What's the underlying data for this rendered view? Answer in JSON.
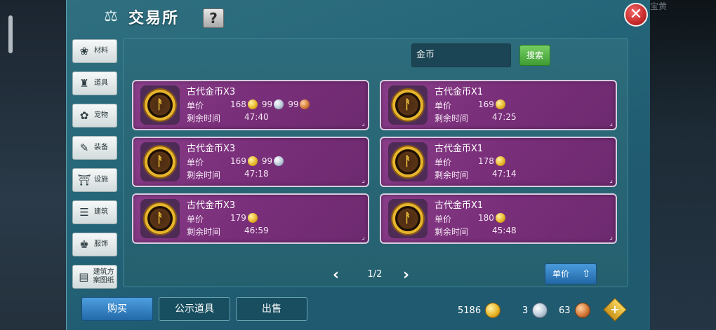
{
  "window": {
    "title": "交易所",
    "help_label": "?",
    "close_label": "✕",
    "corner_hint": "宝黄"
  },
  "sidebar": {
    "items": [
      {
        "label": "材料",
        "icon": "materials-icon",
        "glyph": "❀"
      },
      {
        "label": "道具",
        "icon": "potion-icon",
        "glyph": "♜"
      },
      {
        "label": "宠物",
        "icon": "paw-icon",
        "glyph": "✿"
      },
      {
        "label": "装备",
        "icon": "armor-icon",
        "glyph": "✎"
      },
      {
        "label": "设施",
        "icon": "facility-icon",
        "glyph": "⛩"
      },
      {
        "label": "建筑",
        "icon": "building-icon",
        "glyph": "☰"
      },
      {
        "label": "服饰",
        "icon": "clothing-icon",
        "glyph": "♚"
      },
      {
        "label": "建筑方案图纸",
        "icon": "blueprint-icon",
        "glyph": "▤"
      }
    ]
  },
  "search": {
    "value": "金币",
    "button_label": "搜索"
  },
  "listings": [
    {
      "name": "古代金币X3",
      "price_label": "单价",
      "time_label": "剩余时间",
      "time": "47:40",
      "prices": [
        {
          "amount": "168",
          "currency": "gold"
        },
        {
          "amount": "99",
          "currency": "silver"
        },
        {
          "amount": "99",
          "currency": "bronze"
        }
      ]
    },
    {
      "name": "古代金币X1",
      "price_label": "单价",
      "time_label": "剩余时间",
      "time": "47:25",
      "prices": [
        {
          "amount": "169",
          "currency": "gold"
        }
      ]
    },
    {
      "name": "古代金币X3",
      "price_label": "单价",
      "time_label": "剩余时间",
      "time": "47:18",
      "prices": [
        {
          "amount": "169",
          "currency": "gold"
        },
        {
          "amount": "99",
          "currency": "silver"
        }
      ]
    },
    {
      "name": "古代金币X1",
      "price_label": "单价",
      "time_label": "剩余时间",
      "time": "47:14",
      "prices": [
        {
          "amount": "178",
          "currency": "gold"
        }
      ]
    },
    {
      "name": "古代金币X3",
      "price_label": "单价",
      "time_label": "剩余时间",
      "time": "46:59",
      "prices": [
        {
          "amount": "179",
          "currency": "gold"
        }
      ]
    },
    {
      "name": "古代金币X1",
      "price_label": "单价",
      "time_label": "剩余时间",
      "time": "45:48",
      "prices": [
        {
          "amount": "180",
          "currency": "gold"
        }
      ]
    }
  ],
  "pagination": {
    "prev_label": "‹",
    "next_label": "›",
    "text": "1/2"
  },
  "sort": {
    "label": "单价",
    "arrow": "⇧"
  },
  "tabs": {
    "buy": "购买",
    "public": "公示道具",
    "sell": "出售"
  },
  "wallet": {
    "gold": "5186",
    "silver": "3",
    "bronze": "63",
    "add_label": "+"
  },
  "colors": {
    "panel": "#26677a",
    "card": "#7a2f7a",
    "accent_blue": "#2f7fc3",
    "search_green": "#4caf3f",
    "close_red": "#c72a2a"
  }
}
